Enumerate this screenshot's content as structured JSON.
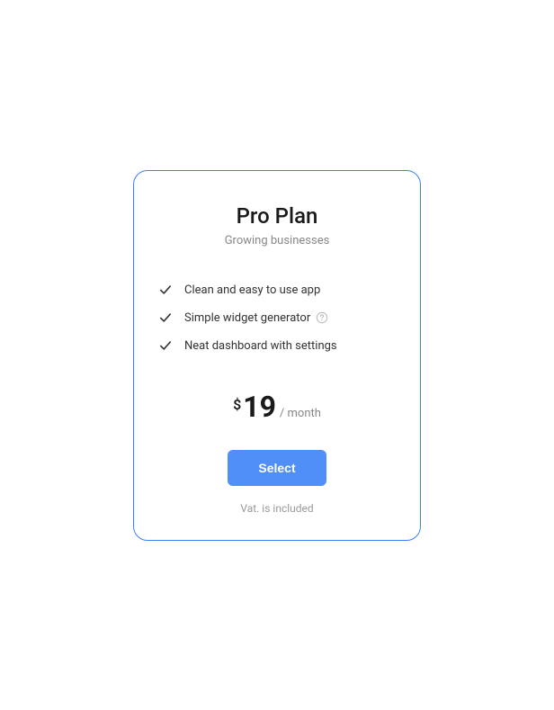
{
  "plan": {
    "title": "Pro Plan",
    "subtitle": "Growing businesses",
    "features": [
      {
        "label": "Clean and easy to use app",
        "has_help": false
      },
      {
        "label": "Simple widget generator",
        "has_help": true
      },
      {
        "label": "Neat dashboard with settings",
        "has_help": false
      }
    ],
    "price": {
      "currency": "$",
      "amount": "19",
      "period": "/ month"
    },
    "cta_label": "Select",
    "vat_note": "Vat. is included"
  },
  "colors": {
    "accent": "#4f8ff7",
    "border": "#3b82f6"
  }
}
